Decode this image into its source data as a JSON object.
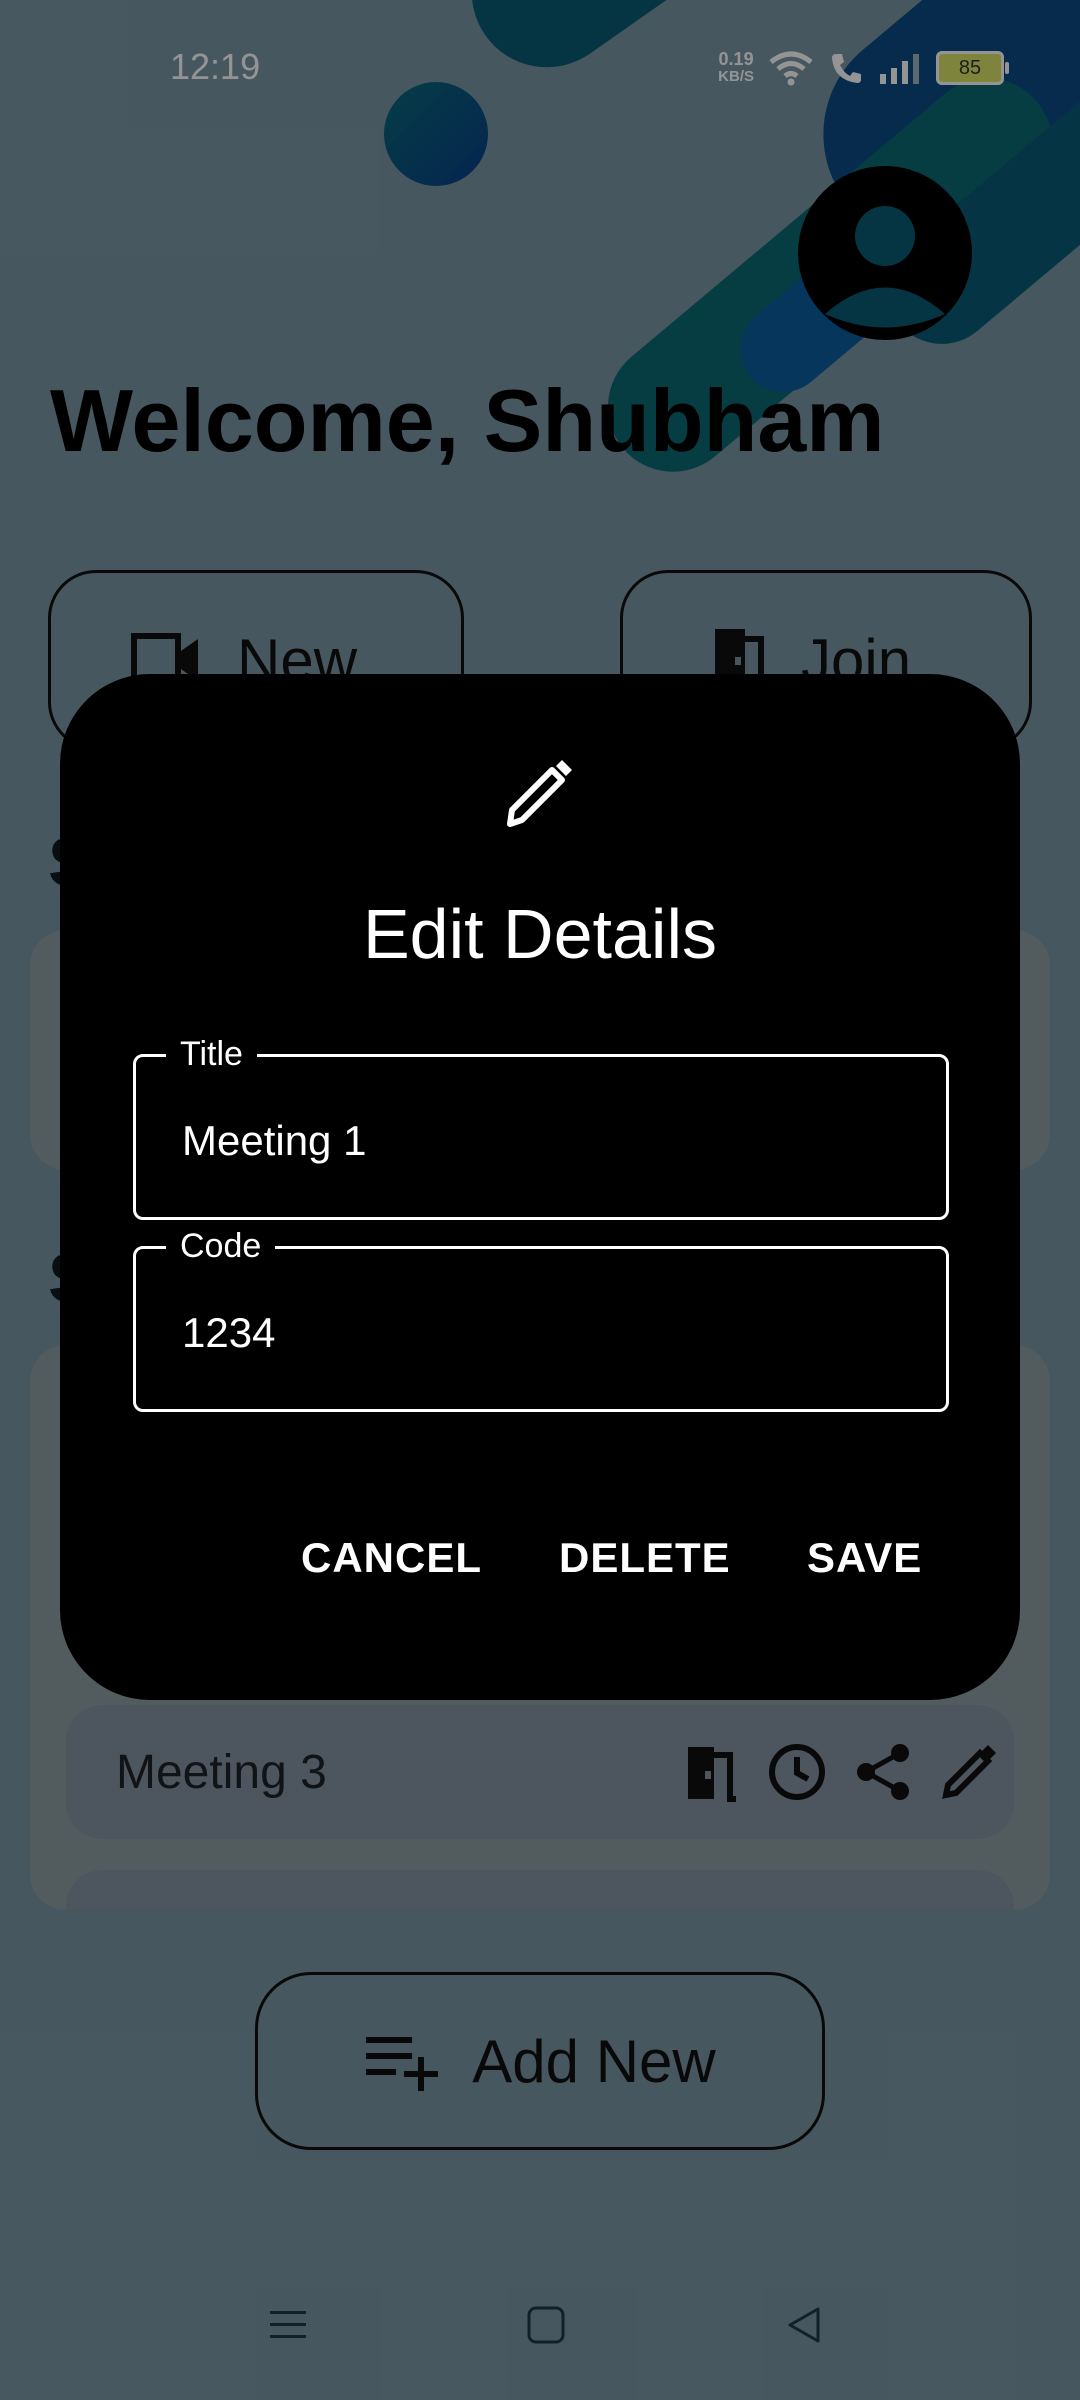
{
  "status_bar": {
    "time": "12:19",
    "net_speed_value": "0.19",
    "net_speed_unit": "KB/S",
    "battery": "85"
  },
  "header": {
    "welcome": "Welcome, Shubham"
  },
  "actions": {
    "new_label": "New",
    "join_label": "Join",
    "add_new_label": "Add New"
  },
  "sections": {
    "section1_cut": "S",
    "section2_cut": "S"
  },
  "meetings": {
    "visible_row_label": "Meeting 3",
    "row_icons": [
      "door-icon",
      "clock-icon",
      "share-icon",
      "edit-icon"
    ]
  },
  "dialog": {
    "icon": "pencil-icon",
    "title": "Edit Details",
    "title_field_label": "Title",
    "title_field_value": "Meeting 1",
    "code_field_label": "Code",
    "code_field_value": "1234",
    "cancel_label": "CANCEL",
    "delete_label": "DELETE",
    "save_label": "SAVE"
  },
  "nav": {
    "icons": [
      "menu-icon",
      "home-icon",
      "back-icon"
    ]
  },
  "colors": {
    "background": "#7a97a6",
    "dialog_bg": "#000000",
    "overlay": "rgba(0,0,0,0.42)"
  }
}
